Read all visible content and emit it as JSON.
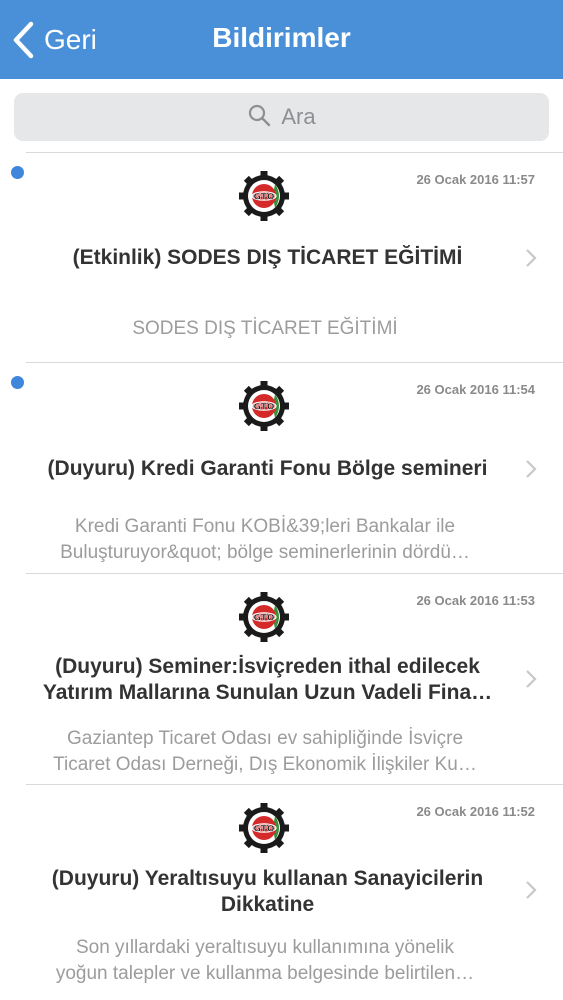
{
  "nav": {
    "back_label": "Geri",
    "title": "Bildirimler"
  },
  "search": {
    "placeholder": "Ara"
  },
  "notifications": [
    {
      "unread": true,
      "date": "26 Ocak 2016 11:57",
      "title": "(Etkinlik) SODES DIŞ TİCARET EĞİTİMİ",
      "description": "SODES DIŞ TİCARET EĞİTİMİ"
    },
    {
      "unread": true,
      "date": "26 Ocak 2016 11:54",
      "title": "(Duyuru) Kredi Garanti Fonu Bölge semineri",
      "description": "Kredi Garanti Fonu KOBİ&39;leri Bankalar ile\nBuluşturuyor&quot;  bölge seminerlerinin dördü…"
    },
    {
      "unread": false,
      "date": "26 Ocak 2016 11:53",
      "title": "(Duyuru) Seminer:İsviçreden ithal edilecek\nYatırım Mallarına Sunulan Uzun Vadeli Fina…",
      "description": "Gaziantep Ticaret Odası ev sahipliğinde İsviçre\nTicaret Odası Derneği, Dış Ekonomik İlişkiler Ku…"
    },
    {
      "unread": false,
      "date": "26 Ocak 2016 11:52",
      "title": "(Duyuru) Yeraltısuyu kullanan Sanayicilerin\nDikkatine",
      "description": "Son yıllardaki yeraltısuyu kullanımına yönelik\nyoğun talepler ve kullanma belgesinde belirtilen…"
    }
  ],
  "logo": {
    "text": "GTO",
    "icon": "gto-logo-icon"
  },
  "colors": {
    "navbar": "#4a90d9",
    "unread_dot": "#3f86dd"
  }
}
